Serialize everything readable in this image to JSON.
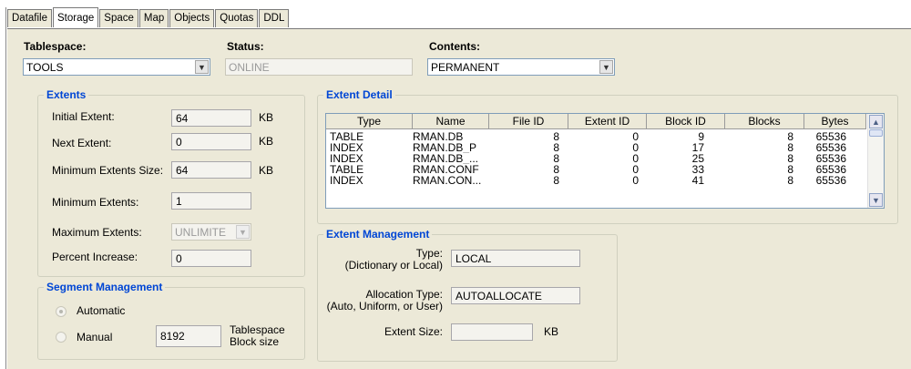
{
  "tabs": [
    "Datafile",
    "Storage",
    "Space",
    "Map",
    "Objects",
    "Quotas",
    "DDL"
  ],
  "active_tab": "Storage",
  "header": {
    "tablespace_label": "Tablespace:",
    "tablespace_value": "TOOLS",
    "status_label": "Status:",
    "status_value": "ONLINE",
    "contents_label": "Contents:",
    "contents_value": "PERMANENT"
  },
  "extents": {
    "title": "Extents",
    "initial_label": "Initial Extent:",
    "initial_value": "64",
    "initial_unit": "KB",
    "next_label": "Next Extent:",
    "next_value": "0",
    "next_unit": "KB",
    "min_size_label": "Minimum Extents Size:",
    "min_size_value": "64",
    "min_size_unit": "KB",
    "min_extents_label": "Minimum Extents:",
    "min_extents_value": "1",
    "max_extents_label": "Maximum Extents:",
    "max_extents_value": "UNLIMITE",
    "pct_label": "Percent Increase:",
    "pct_value": "0"
  },
  "segment": {
    "title": "Segment Management",
    "automatic_label": "Automatic",
    "manual_label": "Manual",
    "block_size_value": "8192",
    "block_size_label_1": "Tablespace",
    "block_size_label_2": "Block size"
  },
  "extent_detail": {
    "title": "Extent Detail",
    "columns": [
      "Type",
      "Name",
      "File ID",
      "Extent ID",
      "Block ID",
      "Blocks",
      "Bytes"
    ],
    "rows": [
      [
        "TABLE",
        "RMAN.DB",
        "8",
        "0",
        "9",
        "8",
        "65536"
      ],
      [
        "INDEX",
        "RMAN.DB_P",
        "8",
        "0",
        "17",
        "8",
        "65536"
      ],
      [
        "INDEX",
        "RMAN.DB_...",
        "8",
        "0",
        "25",
        "8",
        "65536"
      ],
      [
        "TABLE",
        "RMAN.CONF",
        "8",
        "0",
        "33",
        "8",
        "65536"
      ],
      [
        "INDEX",
        "RMAN.CON...",
        "8",
        "0",
        "41",
        "8",
        "65536"
      ]
    ]
  },
  "extent_mgmt": {
    "title": "Extent Management",
    "type_label": "Type:",
    "type_sub": "(Dictionary or Local)",
    "type_value": "LOCAL",
    "alloc_label": "Allocation Type:",
    "alloc_sub": "(Auto, Uniform, or User)",
    "alloc_value": "AUTOALLOCATE",
    "size_label": "Extent Size:",
    "size_value": "",
    "size_unit": "KB"
  },
  "icons": {
    "dropdown": "chevron-down-icon",
    "scroll_up": "chevron-up-icon",
    "scroll_down": "chevron-down-icon"
  }
}
